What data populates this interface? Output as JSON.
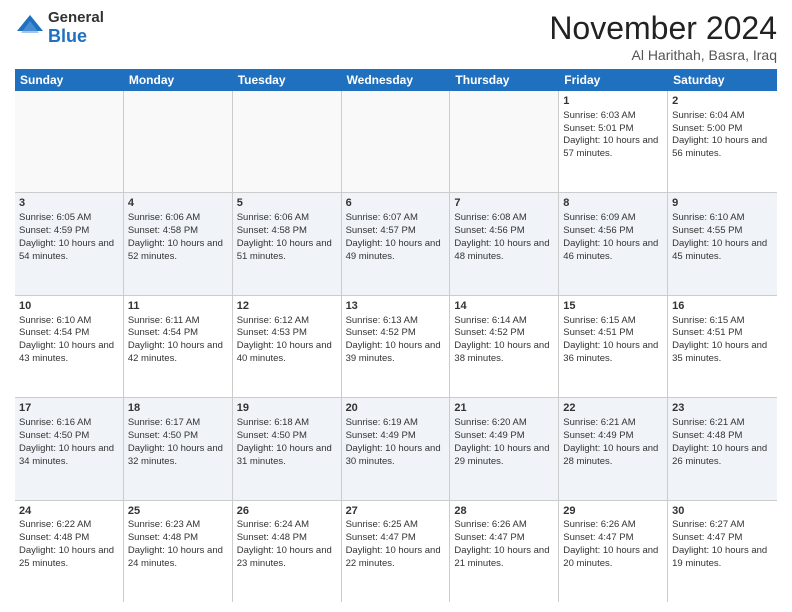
{
  "header": {
    "logo_general": "General",
    "logo_blue": "Blue",
    "month_title": "November 2024",
    "location": "Al Harithah, Basra, Iraq"
  },
  "days_of_week": [
    "Sunday",
    "Monday",
    "Tuesday",
    "Wednesday",
    "Thursday",
    "Friday",
    "Saturday"
  ],
  "weeks": [
    [
      {
        "day": "",
        "empty": true
      },
      {
        "day": "",
        "empty": true
      },
      {
        "day": "",
        "empty": true
      },
      {
        "day": "",
        "empty": true
      },
      {
        "day": "",
        "empty": true
      },
      {
        "day": "1",
        "sunrise": "6:03 AM",
        "sunset": "5:01 PM",
        "daylight": "10 hours and 57 minutes."
      },
      {
        "day": "2",
        "sunrise": "6:04 AM",
        "sunset": "5:00 PM",
        "daylight": "10 hours and 56 minutes."
      }
    ],
    [
      {
        "day": "3",
        "sunrise": "6:05 AM",
        "sunset": "4:59 PM",
        "daylight": "10 hours and 54 minutes."
      },
      {
        "day": "4",
        "sunrise": "6:06 AM",
        "sunset": "4:58 PM",
        "daylight": "10 hours and 52 minutes."
      },
      {
        "day": "5",
        "sunrise": "6:06 AM",
        "sunset": "4:58 PM",
        "daylight": "10 hours and 51 minutes."
      },
      {
        "day": "6",
        "sunrise": "6:07 AM",
        "sunset": "4:57 PM",
        "daylight": "10 hours and 49 minutes."
      },
      {
        "day": "7",
        "sunrise": "6:08 AM",
        "sunset": "4:56 PM",
        "daylight": "10 hours and 48 minutes."
      },
      {
        "day": "8",
        "sunrise": "6:09 AM",
        "sunset": "4:56 PM",
        "daylight": "10 hours and 46 minutes."
      },
      {
        "day": "9",
        "sunrise": "6:10 AM",
        "sunset": "4:55 PM",
        "daylight": "10 hours and 45 minutes."
      }
    ],
    [
      {
        "day": "10",
        "sunrise": "6:10 AM",
        "sunset": "4:54 PM",
        "daylight": "10 hours and 43 minutes."
      },
      {
        "day": "11",
        "sunrise": "6:11 AM",
        "sunset": "4:54 PM",
        "daylight": "10 hours and 42 minutes."
      },
      {
        "day": "12",
        "sunrise": "6:12 AM",
        "sunset": "4:53 PM",
        "daylight": "10 hours and 40 minutes."
      },
      {
        "day": "13",
        "sunrise": "6:13 AM",
        "sunset": "4:52 PM",
        "daylight": "10 hours and 39 minutes."
      },
      {
        "day": "14",
        "sunrise": "6:14 AM",
        "sunset": "4:52 PM",
        "daylight": "10 hours and 38 minutes."
      },
      {
        "day": "15",
        "sunrise": "6:15 AM",
        "sunset": "4:51 PM",
        "daylight": "10 hours and 36 minutes."
      },
      {
        "day": "16",
        "sunrise": "6:15 AM",
        "sunset": "4:51 PM",
        "daylight": "10 hours and 35 minutes."
      }
    ],
    [
      {
        "day": "17",
        "sunrise": "6:16 AM",
        "sunset": "4:50 PM",
        "daylight": "10 hours and 34 minutes."
      },
      {
        "day": "18",
        "sunrise": "6:17 AM",
        "sunset": "4:50 PM",
        "daylight": "10 hours and 32 minutes."
      },
      {
        "day": "19",
        "sunrise": "6:18 AM",
        "sunset": "4:50 PM",
        "daylight": "10 hours and 31 minutes."
      },
      {
        "day": "20",
        "sunrise": "6:19 AM",
        "sunset": "4:49 PM",
        "daylight": "10 hours and 30 minutes."
      },
      {
        "day": "21",
        "sunrise": "6:20 AM",
        "sunset": "4:49 PM",
        "daylight": "10 hours and 29 minutes."
      },
      {
        "day": "22",
        "sunrise": "6:21 AM",
        "sunset": "4:49 PM",
        "daylight": "10 hours and 28 minutes."
      },
      {
        "day": "23",
        "sunrise": "6:21 AM",
        "sunset": "4:48 PM",
        "daylight": "10 hours and 26 minutes."
      }
    ],
    [
      {
        "day": "24",
        "sunrise": "6:22 AM",
        "sunset": "4:48 PM",
        "daylight": "10 hours and 25 minutes."
      },
      {
        "day": "25",
        "sunrise": "6:23 AM",
        "sunset": "4:48 PM",
        "daylight": "10 hours and 24 minutes."
      },
      {
        "day": "26",
        "sunrise": "6:24 AM",
        "sunset": "4:48 PM",
        "daylight": "10 hours and 23 minutes."
      },
      {
        "day": "27",
        "sunrise": "6:25 AM",
        "sunset": "4:47 PM",
        "daylight": "10 hours and 22 minutes."
      },
      {
        "day": "28",
        "sunrise": "6:26 AM",
        "sunset": "4:47 PM",
        "daylight": "10 hours and 21 minutes."
      },
      {
        "day": "29",
        "sunrise": "6:26 AM",
        "sunset": "4:47 PM",
        "daylight": "10 hours and 20 minutes."
      },
      {
        "day": "30",
        "sunrise": "6:27 AM",
        "sunset": "4:47 PM",
        "daylight": "10 hours and 19 minutes."
      }
    ]
  ]
}
